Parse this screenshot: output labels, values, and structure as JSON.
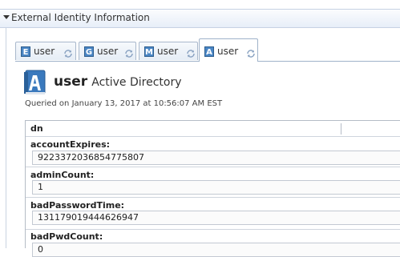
{
  "section": {
    "title": "External Identity Information"
  },
  "tabs": [
    {
      "badge": "E",
      "label": "user",
      "badge_color": "#4a86c5"
    },
    {
      "badge": "G",
      "label": "user",
      "badge_color": "#4a86c5"
    },
    {
      "badge": "M",
      "label": "user",
      "badge_color": "#4a86c5"
    },
    {
      "badge": "A",
      "label": "user",
      "badge_color": "#4a86c5",
      "active": true
    }
  ],
  "identity": {
    "name": "user",
    "directory": "Active Directory",
    "queried": "Queried on January 13, 2017 at 10:56:07 AM EST",
    "icon": "active-directory-book-icon"
  },
  "attributes": [
    {
      "name": "dn",
      "value": ""
    },
    {
      "name": "accountExpires:",
      "value": "9223372036854775807"
    },
    {
      "name": "adminCount:",
      "value": "1"
    },
    {
      "name": "badPasswordTime:",
      "value": "131179019444626947"
    },
    {
      "name": "badPwdCount:",
      "value": "0"
    }
  ],
  "colors": {
    "accent": "#4a86c5",
    "header_bg": "#e7eef8"
  }
}
